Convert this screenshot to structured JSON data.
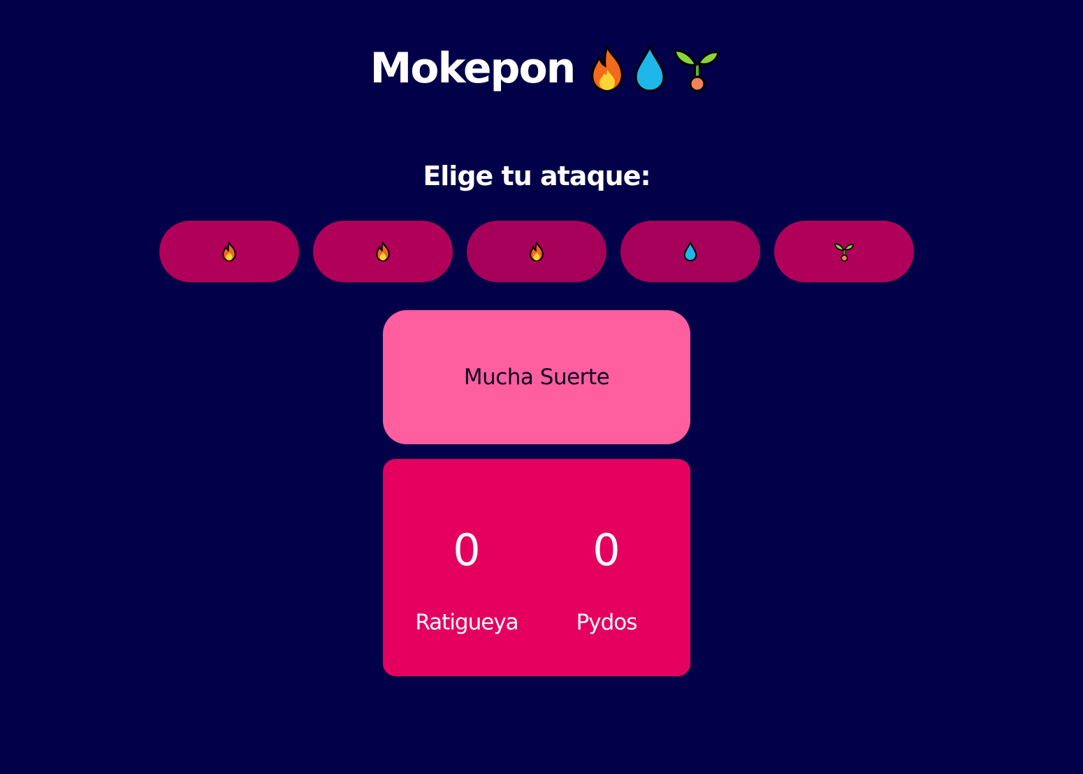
{
  "header": {
    "title": "Mokepon",
    "icons": [
      "fire-icon",
      "water-drop-icon",
      "seedling-icon"
    ]
  },
  "attack_section": {
    "prompt": "Elige tu ataque:",
    "buttons": [
      {
        "icon": "fire-icon",
        "label": "🔥"
      },
      {
        "icon": "fire-icon",
        "label": "🔥"
      },
      {
        "icon": "fire-icon",
        "label": "🔥"
      },
      {
        "icon": "water-drop-icon",
        "label": "💧"
      },
      {
        "icon": "seedling-icon",
        "label": "🌱"
      }
    ]
  },
  "message": {
    "text": "Mucha Suerte"
  },
  "score": {
    "player": {
      "value": "0",
      "name": "Ratigueya"
    },
    "enemy": {
      "value": "0",
      "name": "Pydos"
    }
  },
  "colors": {
    "background": "#010048",
    "attack_button": "#b10059",
    "message_box": "#ff5e9f",
    "score_box": "#e5005f"
  }
}
